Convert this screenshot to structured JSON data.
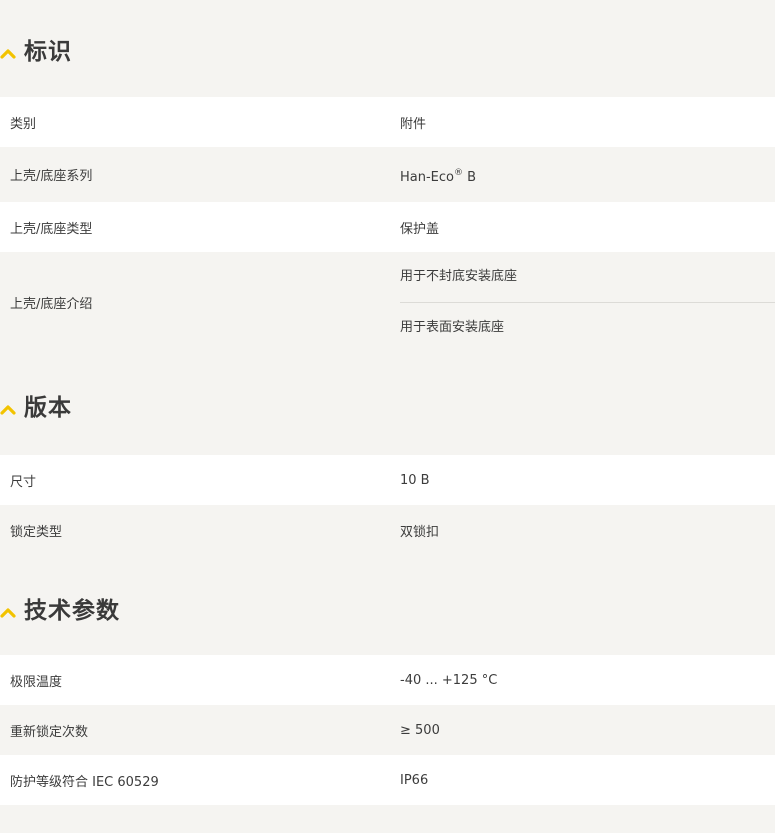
{
  "sections": [
    {
      "title": "标识",
      "rows": [
        {
          "label": "类别",
          "value": "附件"
        },
        {
          "label": "上壳/底座系列",
          "value_main": "Han-Eco",
          "value_sup": "®",
          "value_tail": " B"
        },
        {
          "label": "上壳/底座类型",
          "value": "保护盖"
        },
        {
          "label": "上壳/底座介绍",
          "values": [
            "用于不封底安装底座",
            "用于表面安装底座"
          ]
        }
      ]
    },
    {
      "title": "版本",
      "rows": [
        {
          "label": "尺寸",
          "value": "10 B"
        },
        {
          "label": "锁定类型",
          "value": "双锁扣"
        }
      ]
    },
    {
      "title": "技术参数",
      "rows": [
        {
          "label": "极限温度",
          "value": "-40 ... +125 °C"
        },
        {
          "label": "重新锁定次数",
          "value": "≥ 500"
        },
        {
          "label": "防护等级符合 IEC 60529",
          "value": "IP66"
        }
      ]
    }
  ],
  "colors": {
    "accent": "#f2c300",
    "background": "#f5f4f1",
    "row_white": "#ffffff",
    "text": "#3c3c3c"
  },
  "icons": {
    "section_toggle": "chevron-up-icon"
  }
}
